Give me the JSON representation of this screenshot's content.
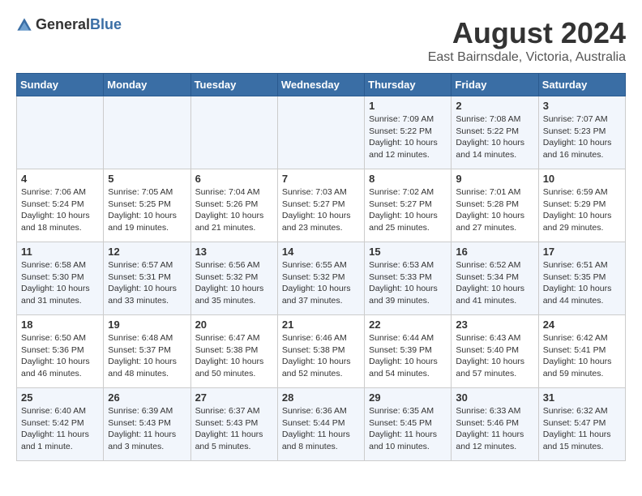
{
  "logo": {
    "general": "General",
    "blue": "Blue"
  },
  "title": "August 2024",
  "subtitle": "East Bairnsdale, Victoria, Australia",
  "headers": [
    "Sunday",
    "Monday",
    "Tuesday",
    "Wednesday",
    "Thursday",
    "Friday",
    "Saturday"
  ],
  "weeks": [
    [
      {
        "day": "",
        "content": ""
      },
      {
        "day": "",
        "content": ""
      },
      {
        "day": "",
        "content": ""
      },
      {
        "day": "",
        "content": ""
      },
      {
        "day": "1",
        "content": "Sunrise: 7:09 AM\nSunset: 5:22 PM\nDaylight: 10 hours\nand 12 minutes."
      },
      {
        "day": "2",
        "content": "Sunrise: 7:08 AM\nSunset: 5:22 PM\nDaylight: 10 hours\nand 14 minutes."
      },
      {
        "day": "3",
        "content": "Sunrise: 7:07 AM\nSunset: 5:23 PM\nDaylight: 10 hours\nand 16 minutes."
      }
    ],
    [
      {
        "day": "4",
        "content": "Sunrise: 7:06 AM\nSunset: 5:24 PM\nDaylight: 10 hours\nand 18 minutes."
      },
      {
        "day": "5",
        "content": "Sunrise: 7:05 AM\nSunset: 5:25 PM\nDaylight: 10 hours\nand 19 minutes."
      },
      {
        "day": "6",
        "content": "Sunrise: 7:04 AM\nSunset: 5:26 PM\nDaylight: 10 hours\nand 21 minutes."
      },
      {
        "day": "7",
        "content": "Sunrise: 7:03 AM\nSunset: 5:27 PM\nDaylight: 10 hours\nand 23 minutes."
      },
      {
        "day": "8",
        "content": "Sunrise: 7:02 AM\nSunset: 5:27 PM\nDaylight: 10 hours\nand 25 minutes."
      },
      {
        "day": "9",
        "content": "Sunrise: 7:01 AM\nSunset: 5:28 PM\nDaylight: 10 hours\nand 27 minutes."
      },
      {
        "day": "10",
        "content": "Sunrise: 6:59 AM\nSunset: 5:29 PM\nDaylight: 10 hours\nand 29 minutes."
      }
    ],
    [
      {
        "day": "11",
        "content": "Sunrise: 6:58 AM\nSunset: 5:30 PM\nDaylight: 10 hours\nand 31 minutes."
      },
      {
        "day": "12",
        "content": "Sunrise: 6:57 AM\nSunset: 5:31 PM\nDaylight: 10 hours\nand 33 minutes."
      },
      {
        "day": "13",
        "content": "Sunrise: 6:56 AM\nSunset: 5:32 PM\nDaylight: 10 hours\nand 35 minutes."
      },
      {
        "day": "14",
        "content": "Sunrise: 6:55 AM\nSunset: 5:32 PM\nDaylight: 10 hours\nand 37 minutes."
      },
      {
        "day": "15",
        "content": "Sunrise: 6:53 AM\nSunset: 5:33 PM\nDaylight: 10 hours\nand 39 minutes."
      },
      {
        "day": "16",
        "content": "Sunrise: 6:52 AM\nSunset: 5:34 PM\nDaylight: 10 hours\nand 41 minutes."
      },
      {
        "day": "17",
        "content": "Sunrise: 6:51 AM\nSunset: 5:35 PM\nDaylight: 10 hours\nand 44 minutes."
      }
    ],
    [
      {
        "day": "18",
        "content": "Sunrise: 6:50 AM\nSunset: 5:36 PM\nDaylight: 10 hours\nand 46 minutes."
      },
      {
        "day": "19",
        "content": "Sunrise: 6:48 AM\nSunset: 5:37 PM\nDaylight: 10 hours\nand 48 minutes."
      },
      {
        "day": "20",
        "content": "Sunrise: 6:47 AM\nSunset: 5:38 PM\nDaylight: 10 hours\nand 50 minutes."
      },
      {
        "day": "21",
        "content": "Sunrise: 6:46 AM\nSunset: 5:38 PM\nDaylight: 10 hours\nand 52 minutes."
      },
      {
        "day": "22",
        "content": "Sunrise: 6:44 AM\nSunset: 5:39 PM\nDaylight: 10 hours\nand 54 minutes."
      },
      {
        "day": "23",
        "content": "Sunrise: 6:43 AM\nSunset: 5:40 PM\nDaylight: 10 hours\nand 57 minutes."
      },
      {
        "day": "24",
        "content": "Sunrise: 6:42 AM\nSunset: 5:41 PM\nDaylight: 10 hours\nand 59 minutes."
      }
    ],
    [
      {
        "day": "25",
        "content": "Sunrise: 6:40 AM\nSunset: 5:42 PM\nDaylight: 11 hours\nand 1 minute."
      },
      {
        "day": "26",
        "content": "Sunrise: 6:39 AM\nSunset: 5:43 PM\nDaylight: 11 hours\nand 3 minutes."
      },
      {
        "day": "27",
        "content": "Sunrise: 6:37 AM\nSunset: 5:43 PM\nDaylight: 11 hours\nand 5 minutes."
      },
      {
        "day": "28",
        "content": "Sunrise: 6:36 AM\nSunset: 5:44 PM\nDaylight: 11 hours\nand 8 minutes."
      },
      {
        "day": "29",
        "content": "Sunrise: 6:35 AM\nSunset: 5:45 PM\nDaylight: 11 hours\nand 10 minutes."
      },
      {
        "day": "30",
        "content": "Sunrise: 6:33 AM\nSunset: 5:46 PM\nDaylight: 11 hours\nand 12 minutes."
      },
      {
        "day": "31",
        "content": "Sunrise: 6:32 AM\nSunset: 5:47 PM\nDaylight: 11 hours\nand 15 minutes."
      }
    ]
  ]
}
